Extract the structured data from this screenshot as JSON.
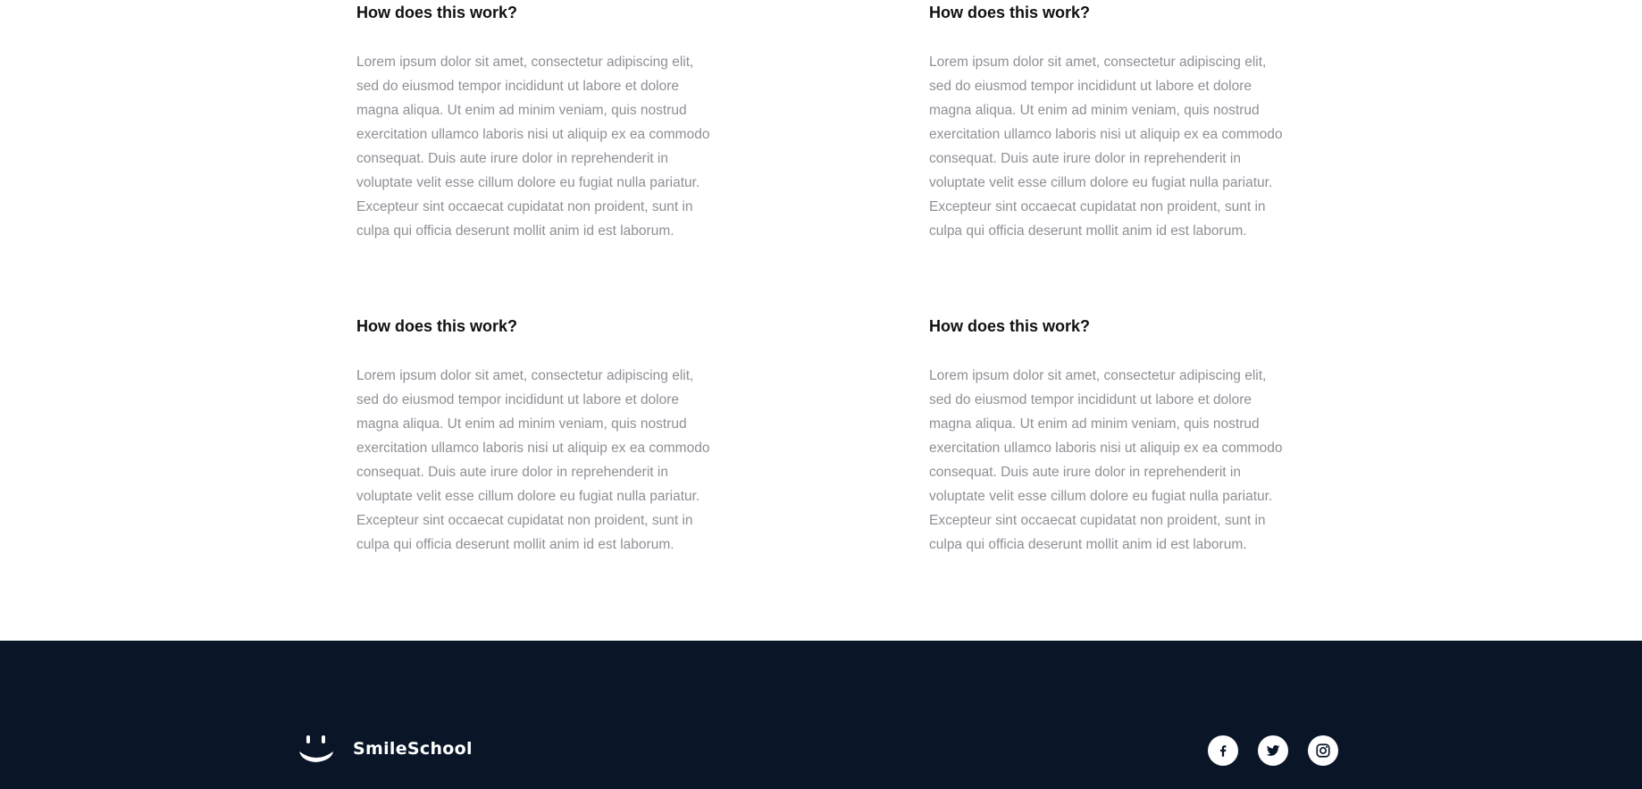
{
  "faq": {
    "items": [
      {
        "question": "How does this work?",
        "answer": "Lorem ipsum dolor sit amet, consectetur adipiscing elit, sed do eiusmod tempor incididunt ut labore et dolore magna aliqua. Ut enim ad minim veniam, quis nostrud exercitation ullamco laboris nisi ut aliquip ex ea commodo consequat. Duis aute irure dolor in reprehenderit in voluptate velit esse cillum dolore eu fugiat nulla pariatur. Excepteur sint occaecat cupidatat non proident, sunt in culpa qui officia deserunt mollit anim id est laborum."
      },
      {
        "question": "How does this work?",
        "answer": "Lorem ipsum dolor sit amet, consectetur adipiscing elit, sed do eiusmod tempor incididunt ut labore et dolore magna aliqua. Ut enim ad minim veniam, quis nostrud exercitation ullamco laboris nisi ut aliquip ex ea commodo consequat. Duis aute irure dolor in reprehenderit in voluptate velit esse cillum dolore eu fugiat nulla pariatur. Excepteur sint occaecat cupidatat non proident, sunt in culpa qui officia deserunt mollit anim id est laborum."
      },
      {
        "question": "How does this work?",
        "answer": "Lorem ipsum dolor sit amet, consectetur adipiscing elit, sed do eiusmod tempor incididunt ut labore et dolore magna aliqua. Ut enim ad minim veniam, quis nostrud exercitation ullamco laboris nisi ut aliquip ex ea commodo consequat. Duis aute irure dolor in reprehenderit in voluptate velit esse cillum dolore eu fugiat nulla pariatur. Excepteur sint occaecat cupidatat non proident, sunt in culpa qui officia deserunt mollit anim id est laborum."
      },
      {
        "question": "How does this work?",
        "answer": "Lorem ipsum dolor sit amet, consectetur adipiscing elit, sed do eiusmod tempor incididunt ut labore et dolore magna aliqua. Ut enim ad minim veniam, quis nostrud exercitation ullamco laboris nisi ut aliquip ex ea commodo consequat. Duis aute irure dolor in reprehenderit in voluptate velit esse cillum dolore eu fugiat nulla pariatur. Excepteur sint occaecat cupidatat non proident, sunt in culpa qui officia deserunt mollit anim id est laborum."
      }
    ]
  },
  "footer": {
    "brand": "SmileSchool",
    "logo_icon": "smile-logo-icon",
    "social": [
      {
        "icon": "facebook-icon"
      },
      {
        "icon": "twitter-icon"
      },
      {
        "icon": "instagram-icon"
      }
    ]
  },
  "colors": {
    "footer_bg": "#0a1628",
    "question_text": "#111111",
    "answer_text": "#8f8f97",
    "icon_bg": "#ffffff"
  }
}
